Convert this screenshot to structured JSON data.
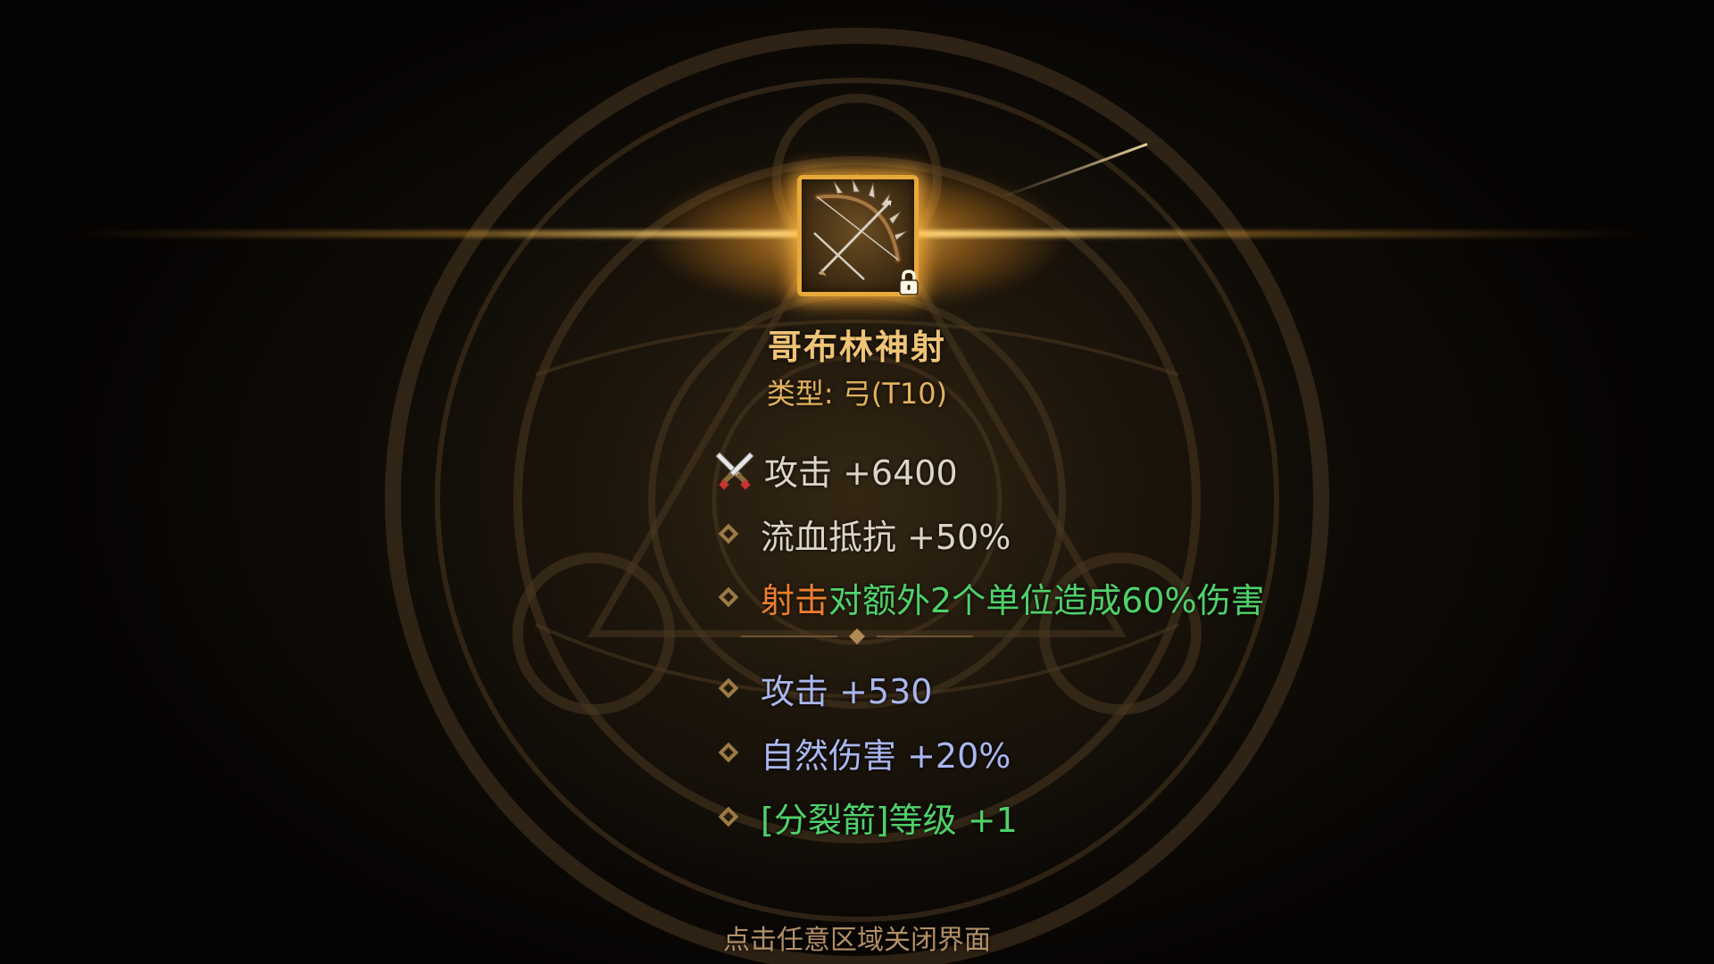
{
  "item": {
    "name": "哥布林神射",
    "type_line": "类型: 弓(T10)",
    "icon": "bow-icon",
    "locked": true
  },
  "base_stats": [
    {
      "icon": "crossed-swords-icon",
      "label": "攻击 +6400"
    },
    {
      "icon": "diamond-bullet-icon",
      "label": "流血抵抗 +50%"
    }
  ],
  "skill": {
    "name": "射击",
    "description": "对额外2个单位造成60%伤害"
  },
  "bonus_stats": [
    {
      "label": "攻击 +530"
    },
    {
      "label": "自然伤害 +20%"
    },
    {
      "label": "[分裂箭]等级 +1"
    }
  ],
  "footer": {
    "close_hint": "点击任意区域关闭界面"
  },
  "colors": {
    "title": "#efc476",
    "skill_name": "#ef7f2d",
    "skill_desc": "#4fd16a",
    "bonus_stat": "#aab6ee",
    "skill_level_stat": "#4fd16a",
    "frame": "#e7a93a"
  }
}
